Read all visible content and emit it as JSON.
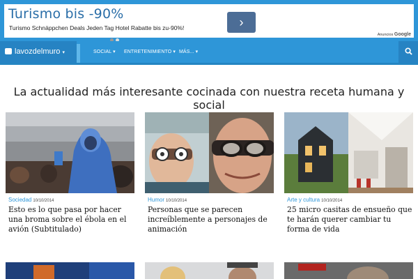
{
  "ad": {
    "title": "Turismo bis -90%",
    "subtitle": "Turismo Schnäppchen Deals Jeden Tag Hotel Rabatte bis zu-90%!",
    "button_glyph": "›",
    "label_prefix": "Anuncios",
    "label_brand": "Google"
  },
  "nav": {
    "brand": "lavozdelmuro",
    "links": [
      "SOCIAL",
      "ENTRETENIMIENTO",
      "MÁS..."
    ],
    "search_icon": "search-icon"
  },
  "headline": "La actualidad más interesante cocinada con nuestra receta humana y social",
  "cards": [
    {
      "category": "Sociedad",
      "date": "10/10/2014",
      "title": "Esto es lo que pasa por hacer una broma sobre el ébola en el avión (Subtitulado)"
    },
    {
      "category": "Humor",
      "date": "10/10/2014",
      "title": "Personas que se parecen increíblemente a personajes de animación"
    },
    {
      "category": "Arte y cultura",
      "date": "10/10/2014",
      "title": "25 micro casitas de ensueño que te harán querer cambiar tu forma de vida"
    }
  ],
  "colors": {
    "accent": "#2e96d8",
    "nav_dark": "#2683c3"
  }
}
